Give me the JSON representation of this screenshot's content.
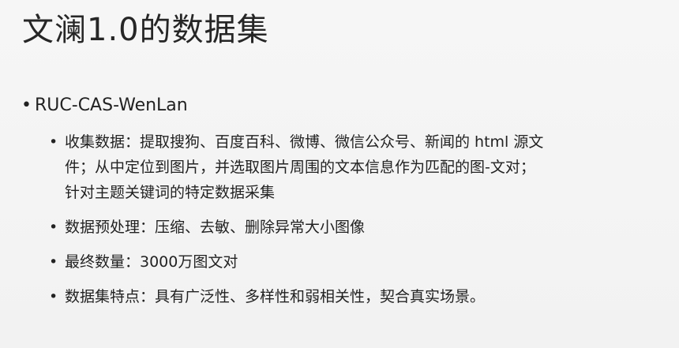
{
  "slide": {
    "title": "文澜1.0的数据集",
    "bullet_char": "•",
    "main_item": "RUC-CAS-WenLan",
    "sub_items": [
      {
        "lines": [
          "收集数据：提取搜狗、百度百科、微博、微信公众号、新闻的 html 源文",
          "件；从中定位到图片，并选取图片周围的文本信息作为匹配的图-文对；",
          "针对主题关键词的特定数据采集"
        ]
      },
      {
        "lines": [
          "数据预处理：压缩、去敏、删除异常大小图像"
        ]
      },
      {
        "lines": [
          "最终数量：3000万图文对"
        ]
      },
      {
        "lines": [
          "数据集特点：具有广泛性、多样性和弱相关性，契合真实场景。"
        ]
      }
    ]
  }
}
